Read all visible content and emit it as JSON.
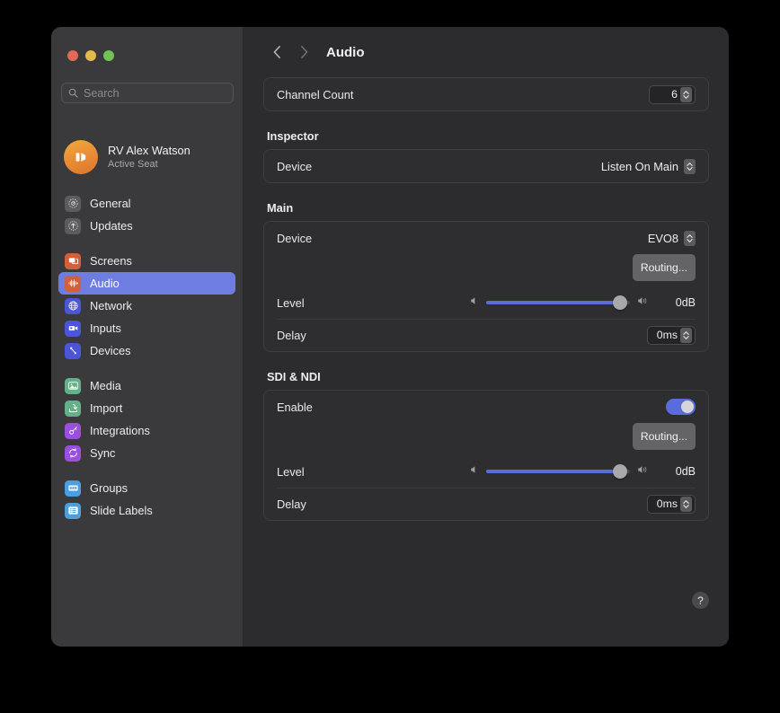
{
  "window": {
    "traffic_lights": [
      {
        "name": "close",
        "color": "#e0695a"
      },
      {
        "name": "minimize",
        "color": "#e0bb4a"
      },
      {
        "name": "zoom",
        "color": "#72c254"
      }
    ]
  },
  "sidebar": {
    "search": {
      "value": "",
      "placeholder": "Search"
    },
    "profile": {
      "name": "RV Alex Watson",
      "status": "Active Seat",
      "avatar_color": "#e98a35"
    },
    "groups": [
      {
        "items": [
          {
            "label": "General",
            "icon": "gear-icon",
            "color": "#5c5c5f",
            "selected": false
          },
          {
            "label": "Updates",
            "icon": "arrow-up-circle-icon",
            "color": "#5c5c5f",
            "selected": false
          }
        ]
      },
      {
        "items": [
          {
            "label": "Screens",
            "icon": "screens-icon",
            "color": "#d2603a",
            "selected": false
          },
          {
            "label": "Audio",
            "icon": "waveform-icon",
            "color": "#d2603a",
            "selected": true
          },
          {
            "label": "Network",
            "icon": "globe-icon",
            "color": "#4c54d8",
            "selected": false
          },
          {
            "label": "Inputs",
            "icon": "camera-icon",
            "color": "#4c54d8",
            "selected": false
          },
          {
            "label": "Devices",
            "icon": "device-link-icon",
            "color": "#4c54d8",
            "selected": false
          }
        ]
      },
      {
        "items": [
          {
            "label": "Media",
            "icon": "photo-icon",
            "color": "#63b089",
            "selected": false
          },
          {
            "label": "Import",
            "icon": "import-arrow-icon",
            "color": "#63b089",
            "selected": false
          },
          {
            "label": "Integrations",
            "icon": "key-icon",
            "color": "#9b4fe0",
            "selected": false
          },
          {
            "label": "Sync",
            "icon": "sync-arrows-icon",
            "color": "#9b4fe0",
            "selected": false
          }
        ]
      },
      {
        "items": [
          {
            "label": "Groups",
            "icon": "groups-icon",
            "color": "#4a9fe0",
            "selected": false
          },
          {
            "label": "Slide Labels",
            "icon": "list-icon",
            "color": "#4a9fe0",
            "selected": false
          }
        ]
      }
    ]
  },
  "content": {
    "title": "Audio",
    "nav": {
      "back": "‹",
      "forward": "›"
    },
    "channel_count": {
      "label": "Channel Count",
      "value": "6"
    },
    "inspector": {
      "title": "Inspector",
      "device": {
        "label": "Device",
        "value": "Listen On Main"
      }
    },
    "main": {
      "title": "Main",
      "device": {
        "label": "Device",
        "value": "EVO8"
      },
      "routing_label": "Routing...",
      "level": {
        "label": "Level",
        "value": "0dB",
        "percent": 93
      },
      "delay": {
        "label": "Delay",
        "value": "0ms"
      }
    },
    "sdi_ndi": {
      "title": "SDI & NDI",
      "enable": {
        "label": "Enable",
        "on": true
      },
      "routing_label": "Routing...",
      "level": {
        "label": "Level",
        "value": "0dB",
        "percent": 93
      },
      "delay": {
        "label": "Delay",
        "value": "0ms"
      }
    },
    "help_label": "?"
  },
  "colors": {
    "accent": "#5a6cdc",
    "selection": "#6e7ee0",
    "sidebar_bg": "#3a3a3c",
    "content_bg": "#2c2c2e",
    "card_bg": "#2e2e30"
  }
}
